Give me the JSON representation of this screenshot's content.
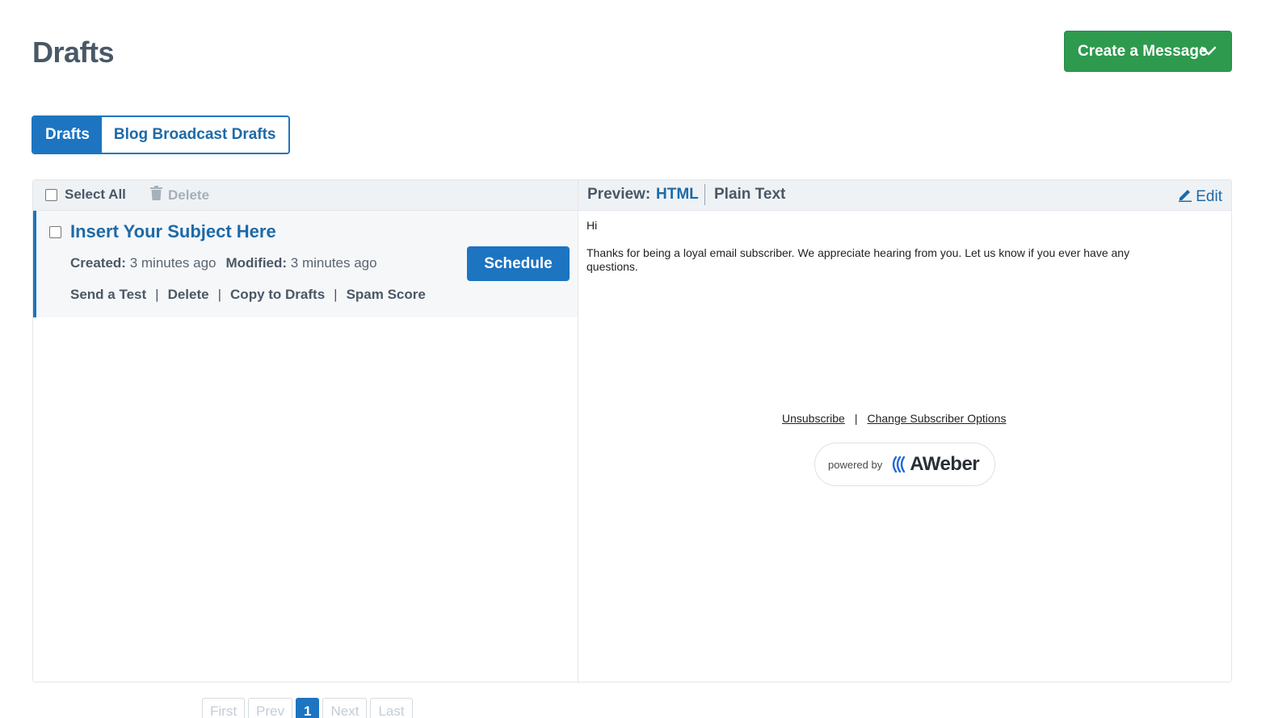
{
  "page": {
    "title": "Drafts"
  },
  "header": {
    "create_label": "Create a Message",
    "create_icon": "chevron-down-icon"
  },
  "tabs": [
    {
      "label": "Drafts",
      "active": true
    },
    {
      "label": "Blog Broadcast Drafts",
      "active": false
    }
  ],
  "toolbar": {
    "select_all_label": "Select All",
    "delete_label": "Delete",
    "delete_icon": "trash-icon"
  },
  "draft": {
    "subject": "Insert Your Subject Here",
    "created_label": "Created:",
    "created_value": "3 minutes ago",
    "modified_label": "Modified:",
    "modified_value": "3 minutes ago",
    "actions": [
      "Send a Test",
      "Delete",
      "Copy to Drafts",
      "Spam Score"
    ],
    "separator": "|",
    "schedule_label": "Schedule"
  },
  "preview": {
    "label": "Preview:",
    "html_label": "HTML",
    "plain_label": "Plain Text",
    "edit_label": "Edit",
    "edit_icon": "pencil-icon",
    "body_line1": "Hi",
    "body_line2": "Thanks for being a loyal email subscriber. We appreciate hearing from you. Let us know if you ever have any questions.",
    "unsubscribe_label": "Unsubscribe",
    "footer_separator": "|",
    "change_options_label": "Change Subscriber Options",
    "powered_by": "powered by",
    "brand": "AWeber"
  },
  "pagination": {
    "first": "First",
    "prev": "Prev",
    "current": "1",
    "next": "Next",
    "last": "Last"
  },
  "colors": {
    "primary": "#1d74c1",
    "success": "#2e9a4e",
    "title": "#4a5866"
  }
}
